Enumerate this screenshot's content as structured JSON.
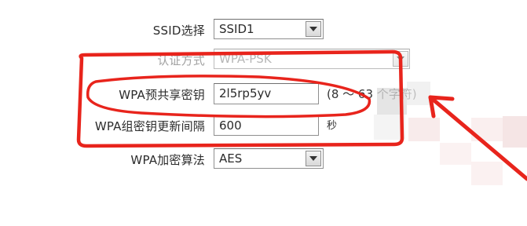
{
  "form": {
    "ssid_select": {
      "label": "SSID选择",
      "value": "SSID1"
    },
    "auth_mode": {
      "label": "认证方式",
      "value": "WPA-PSK"
    },
    "psk": {
      "label": "WPA预共享密钥",
      "value": "2l5rp5yv",
      "hint": "(8 ～ 63 个字符)"
    },
    "rekey_interval": {
      "label": "WPA组密钥更新间隔",
      "value": "600",
      "unit": "秒"
    },
    "encryption": {
      "label": "WPA加密算法",
      "value": "AES"
    }
  },
  "annotation": {
    "highlight_color": "#e8241c",
    "arrow_color": "#e8241c"
  }
}
